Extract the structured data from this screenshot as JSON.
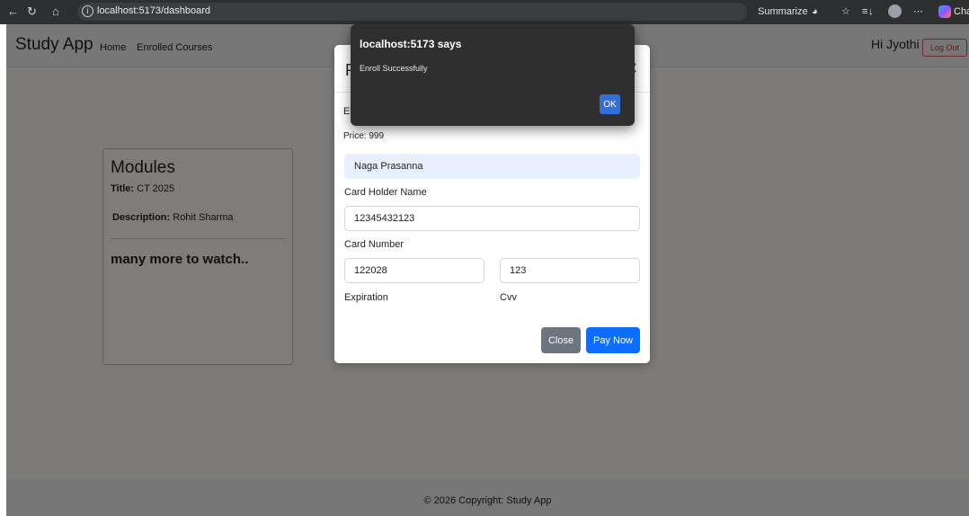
{
  "browser": {
    "url": "localhost:5173/dashboard",
    "summarize_label": "Summarize",
    "chat_label": "Chat"
  },
  "navbar": {
    "brand": "Study App",
    "links": [
      "Home",
      "Enrolled Courses"
    ],
    "greeting": "Hi Jyothi",
    "logout_label": "Log Out"
  },
  "module_card": {
    "heading": "Modules",
    "title_label": "Title:",
    "title_value": "CT 2025",
    "description_label": "Description:",
    "description_value": "Rohit Sharma",
    "more_text": "many more to watch.."
  },
  "modal": {
    "title_fragment": "P",
    "line_fragment": "E",
    "price": "Price: 999",
    "card_holder_value": "Naga Prasanna",
    "card_holder_label": "Card Holder Name",
    "card_number_value": "12345432123",
    "card_number_label": "Card Number",
    "expiration_value": "122028",
    "expiration_label": "Expiration",
    "cvv_value": "123",
    "cvv_label": "Cvv",
    "close_label": "Close",
    "pay_label": "Pay Now"
  },
  "alert": {
    "title": "localhost:5173 says",
    "message": "Enroll Successfully",
    "ok_label": "OK"
  },
  "footer": {
    "text": "© 2026 Copyright: Study App"
  }
}
